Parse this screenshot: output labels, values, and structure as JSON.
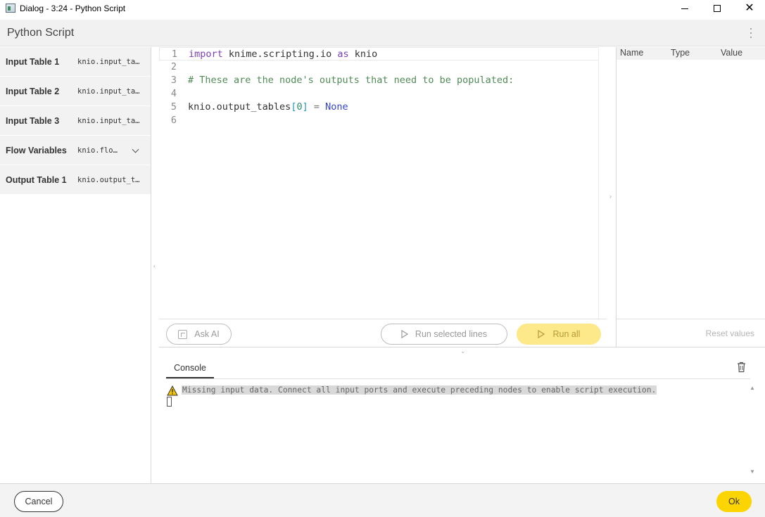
{
  "window": {
    "title": "Dialog - 3:24 - Python Script",
    "icons": [
      "app-icon",
      "minimize-icon",
      "maximize-icon",
      "close-icon"
    ]
  },
  "header": {
    "title": "Python Script",
    "menu_icon": "kebab-menu-icon"
  },
  "sidebar": {
    "items": [
      {
        "label": "Input Table 1",
        "code": "knio.input_ta…"
      },
      {
        "label": "Input Table 2",
        "code": "knio.input_ta…"
      },
      {
        "label": "Input Table 3",
        "code": "knio.input_ta…"
      },
      {
        "label": "Flow Variables",
        "code": "knio.flo…",
        "expandable": true
      },
      {
        "label": "Output Table 1",
        "code": "knio.output_t…"
      }
    ]
  },
  "editor": {
    "lines": [
      {
        "n": "1",
        "text": "import knime.scripting.io as knio"
      },
      {
        "n": "2",
        "text": ""
      },
      {
        "n": "3",
        "text": "# These are the node's outputs that need to be populated:"
      },
      {
        "n": "4",
        "text": ""
      },
      {
        "n": "5",
        "text": "knio.output_tables[0] = None"
      },
      {
        "n": "6",
        "text": ""
      }
    ],
    "tokens": {
      "import_kw": "import",
      "module": " knime.scripting.io ",
      "as_kw": "as",
      "alias": " knio",
      "comment": "# These are the node's outputs that need to be populated:",
      "target": "knio.output_tables",
      "lbracket": "[",
      "index": "0",
      "rbracket": "]",
      "assign": " = ",
      "none": "None"
    }
  },
  "toolbar": {
    "ask_ai": "Ask AI",
    "run_selected": "Run selected lines",
    "run_all": "Run all"
  },
  "variables": {
    "columns": [
      "Name",
      "Type",
      "Value"
    ],
    "reset": "Reset values"
  },
  "console": {
    "tab": "Console",
    "message": "Missing input data. Connect all input ports and execute preceding nodes to enable script execution.",
    "icons": [
      "warning-icon",
      "trash-icon"
    ]
  },
  "footer": {
    "cancel": "Cancel",
    "ok": "Ok"
  },
  "colors": {
    "accent": "#fcd400",
    "accent_disabled": "#fde88a",
    "header_bg": "#f1f1f1",
    "sidebar_item_bg": "#f2f2f2"
  }
}
